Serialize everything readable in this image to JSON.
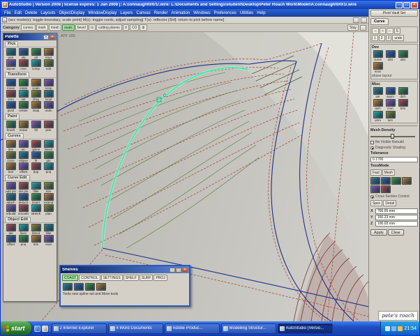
{
  "colors": {
    "accent_highlight": "#3fedae",
    "curve_blue": "#1c2f8a",
    "curve_red": "#a83832",
    "hatch_green": "#4f7830",
    "titlebar_blue": "#0c3fae",
    "taskbar_blue": "#1941a5",
    "start_green": "#2d7f2d"
  },
  "window": {
    "app_icon": "A",
    "title": "AutoStudio | Version 2008 | license expires: 1 Jan 2008 |: A:connaught0/0/1/.wire: L:\\Documents and Settings\\student\\Desktop\\Peter Roach Work\\Model\\A:connaught0/0/1/.wire",
    "minimize": "–",
    "maximize": "□",
    "close": "×"
  },
  "menubar": {
    "items": [
      "File",
      "Edit",
      "Delete",
      "Layouts",
      "ObjectDisplay",
      "WindowDisplay",
      "Layers",
      "Canvas",
      "Render",
      "Animation",
      "Windows",
      "Preferences",
      "Utilities",
      "Help"
    ]
  },
  "prompt": {
    "text": "(acc mode(s): toggle boundary, scale point]  M(s): toggle cords, adjust sampling]  T(s): reflector  [Shf]: return to pick before name]"
  },
  "shelfbar": {
    "category_label": "Category",
    "tabs": [
      {
        "label": "curves"
      },
      {
        "label": "mark"
      },
      {
        "label": "mesh"
      },
      {
        "label": "seats",
        "active": true
      },
      {
        "label": "bevel"
      },
      {
        "label": "rs"
      },
      {
        "label": "cutting planes"
      },
      {
        "label": "rt"
      },
      {
        "label": "CO"
      },
      {
        "label": "dr"
      }
    ],
    "stay_label": "Stay"
  },
  "canvas": {
    "grid_label": "ATF 100",
    "marker_label": "C"
  },
  "palette": {
    "title": "Palette",
    "sections": [
      {
        "title": "Pick",
        "tools": [
          "pick",
          "obj",
          "all",
          "tmpl",
          "layout",
          "crvs",
          "comp",
          "edit"
        ]
      },
      {
        "title": "Transform",
        "tools": [
          "move",
          "rotate",
          "scale",
          "nonp",
          "zero",
          "set",
          "drag",
          "local",
          "pivot",
          "center",
          "snap",
          "undo"
        ]
      },
      {
        "title": "Paint",
        "tools": [
          "brush",
          "erase",
          "fill",
          "pick"
        ]
      },
      {
        "title": "Curves",
        "tools": [
          "line",
          "arc",
          "spline",
          "blend",
          "circle",
          "ellipse",
          "fit",
          "pts",
          "text",
          "offset",
          "dup",
          "proj"
        ]
      },
      {
        "title": "Curve Edit",
        "tools": [
          "add pts",
          "del pts",
          "fillet",
          "trim",
          "attach",
          "detach",
          "insert",
          "extend",
          "rebuild",
          "smooth",
          "stretch",
          "plan"
        ]
      },
      {
        "title": "Object Edit",
        "tools": [
          "del",
          "lines",
          "blend",
          "fillet",
          "offset",
          "proj",
          "trim",
          "eval"
        ]
      }
    ]
  },
  "shelves": {
    "title": "Shelves",
    "tabs": [
      {
        "label": "COAST",
        "active": true
      },
      {
        "label": "CONTROL"
      },
      {
        "label": "SETTINGS"
      },
      {
        "label": "SHELF"
      },
      {
        "label": "SURF"
      },
      {
        "label": "PROJ"
      }
    ],
    "tools": [
      "curve-tool",
      "surface-tool",
      "mesh-tool",
      "eval-tool"
    ],
    "caption": "Tools   new spline set   and More tools"
  },
  "controlPanel": {
    "header": "Pivot Vault Set",
    "tab": "Curve",
    "curves": {
      "glyphs": [
        "∼",
        "≈",
        "∩",
        "S"
      ],
      "degrees": [
        "1",
        "2",
        "3"
      ],
      "undo_label": "undo"
    },
    "dev": {
      "title": "Dev",
      "tools": [
        "curve",
        "dist",
        "dist",
        "knot"
      ],
      "caption": "phase layout"
    },
    "misc": {
      "title": "Misc",
      "tools": [
        "set",
        "asym",
        "dtch",
        "atch",
        "insrt",
        "trim",
        "utrm",
        "turn"
      ]
    },
    "mesh_density": {
      "label": "Mesh Density",
      "percent": 45
    },
    "rebuild_label": "No Visible Rebuild",
    "shading_label": "Diagnostic Shading",
    "tolerance": {
      "label": "Tolerance",
      "value": "0.1700"
    },
    "tessmode": {
      "label": "TessMode",
      "options": [
        "Fast",
        "Mesh"
      ]
    },
    "cubes": [
      "cube-red",
      "cube-green",
      "cube-blue",
      "cube-teal",
      "cube-gold",
      "cube-violet"
    ],
    "cross_section": {
      "title": "Cross Section Control",
      "modes": [
        "Spec",
        "Detail"
      ],
      "coords": [
        {
          "axis": "X",
          "value": "766.55 mm"
        },
        {
          "axis": "Y",
          "value": "160.23 mm"
        },
        {
          "axis": "Z",
          "value": "100.03 mm"
        }
      ],
      "apply_label": "Apply",
      "clear_label": "Clear"
    }
  },
  "taskbar": {
    "start_label": "start",
    "buttons": [
      {
        "count": "2",
        "label": "Internet Explorer"
      },
      {
        "count": "4",
        "label": "Word Documents"
      },
      {
        "count": "",
        "label": "Adobe Produc..."
      },
      {
        "count": "",
        "label": "Modelling Structur..."
      },
      {
        "count": "",
        "label": "AutoStudio (Versio...",
        "active": true
      }
    ],
    "tray": {
      "time": "21:54"
    }
  },
  "watermark": {
    "text": "pete's roach"
  }
}
